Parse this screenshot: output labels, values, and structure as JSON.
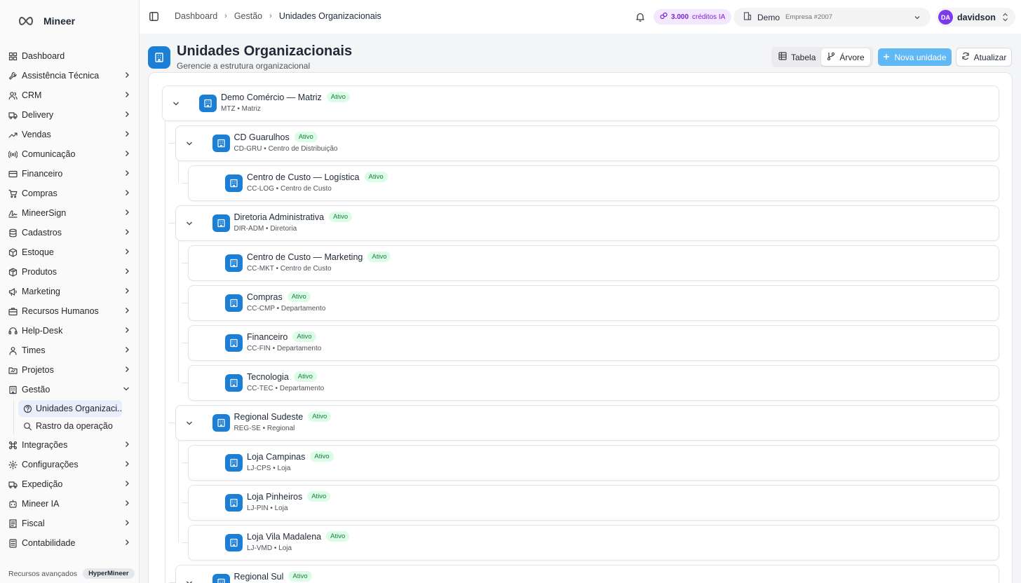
{
  "app": {
    "name": "Mineer"
  },
  "sidebar": {
    "items": [
      {
        "label": "Dashboard",
        "icon": "dashboard-icon",
        "chevron": false
      },
      {
        "label": "Assistência Técnica",
        "icon": "wrench-icon",
        "chevron": true
      },
      {
        "label": "CRM",
        "icon": "users-icon",
        "chevron": true
      },
      {
        "label": "Delivery",
        "icon": "truck-icon",
        "chevron": true
      },
      {
        "label": "Vendas",
        "icon": "trending-up-icon",
        "chevron": true
      },
      {
        "label": "Comunicação",
        "icon": "radio-icon",
        "chevron": true
      },
      {
        "label": "Financeiro",
        "icon": "credit-card-icon",
        "chevron": true
      },
      {
        "label": "Compras",
        "icon": "cart-icon",
        "chevron": true
      },
      {
        "label": "MineerSign",
        "icon": "signature-icon",
        "chevron": true
      },
      {
        "label": "Cadastros",
        "icon": "database-icon",
        "chevron": true
      },
      {
        "label": "Estoque",
        "icon": "package-icon",
        "chevron": true
      },
      {
        "label": "Produtos",
        "icon": "box-icon",
        "chevron": true
      },
      {
        "label": "Marketing",
        "icon": "megaphone-icon",
        "chevron": true
      },
      {
        "label": "Recursos Humanos",
        "icon": "briefcase-icon",
        "chevron": true
      },
      {
        "label": "Help-Desk",
        "icon": "headset-icon",
        "chevron": true
      },
      {
        "label": "Times",
        "icon": "team-icon",
        "chevron": true
      },
      {
        "label": "Projetos",
        "icon": "folder-icon",
        "chevron": true
      },
      {
        "label": "Gestão",
        "icon": "building-icon",
        "chevron": true,
        "expanded": true
      }
    ],
    "gestao_sub": [
      {
        "label": "Unidades Organizaci...",
        "icon": "help-circle-icon",
        "active": true
      },
      {
        "label": "Rastro da operação",
        "icon": "search-icon",
        "active": false
      }
    ],
    "items_after": [
      {
        "label": "Integrações",
        "icon": "command-icon",
        "chevron": true
      },
      {
        "label": "Configurações",
        "icon": "settings-icon",
        "chevron": true
      },
      {
        "label": "Expedição",
        "icon": "shipping-icon",
        "chevron": true
      },
      {
        "label": "Mineer IA",
        "icon": "ai-icon",
        "chevron": true
      },
      {
        "label": "Fiscal",
        "icon": "receipt-icon",
        "chevron": true
      },
      {
        "label": "Contabilidade",
        "icon": "calculator-icon",
        "chevron": true
      }
    ],
    "footer": {
      "label": "Recursos avançados",
      "badge": "HyperMineer"
    }
  },
  "topbar": {
    "breadcrumb": [
      "Dashboard",
      "Gestão",
      "Unidades Organizacionais"
    ],
    "credits": {
      "amount": "3.000",
      "label": "créditos IA"
    },
    "company": {
      "name": "Demo",
      "sub": "Empresa #2007"
    },
    "user": {
      "initials": "DA",
      "name": "davidson"
    }
  },
  "header": {
    "title": "Unidades Organizacionais",
    "subtitle": "Gerencie a estrutura organizacional",
    "view_table": "Tabela",
    "view_tree": "Árvore",
    "new_button": "Nova unidade",
    "refresh_button": "Atualizar"
  },
  "tree": [
    {
      "name": "Demo Comércio — Matriz",
      "status": "Ativo",
      "code": "MTZ",
      "type": "Matriz",
      "level": 0,
      "expandable": true
    },
    {
      "name": "CD Guarulhos",
      "status": "Ativo",
      "code": "CD-GRU",
      "type": "Centro de Distribuição",
      "level": 1,
      "expandable": true
    },
    {
      "name": "Centro de Custo — Logística",
      "status": "Ativo",
      "code": "CC-LOG",
      "type": "Centro de Custo",
      "level": 2,
      "expandable": false
    },
    {
      "name": "Diretoria Administrativa",
      "status": "Ativo",
      "code": "DIR-ADM",
      "type": "Diretoria",
      "level": 1,
      "expandable": true
    },
    {
      "name": "Centro de Custo — Marketing",
      "status": "Ativo",
      "code": "CC-MKT",
      "type": "Centro de Custo",
      "level": 2,
      "expandable": false
    },
    {
      "name": "Compras",
      "status": "Ativo",
      "code": "CC-CMP",
      "type": "Departamento",
      "level": 2,
      "expandable": false
    },
    {
      "name": "Financeiro",
      "status": "Ativo",
      "code": "CC-FIN",
      "type": "Departamento",
      "level": 2,
      "expandable": false
    },
    {
      "name": "Tecnologia",
      "status": "Ativo",
      "code": "CC-TEC",
      "type": "Departamento",
      "level": 2,
      "expandable": false
    },
    {
      "name": "Regional Sudeste",
      "status": "Ativo",
      "code": "REG-SE",
      "type": "Regional",
      "level": 1,
      "expandable": true
    },
    {
      "name": "Loja Campinas",
      "status": "Ativo",
      "code": "LJ-CPS",
      "type": "Loja",
      "level": 2,
      "expandable": false
    },
    {
      "name": "Loja Pinheiros",
      "status": "Ativo",
      "code": "LJ-PIN",
      "type": "Loja",
      "level": 2,
      "expandable": false
    },
    {
      "name": "Loja Vila Madalena",
      "status": "Ativo",
      "code": "LJ-VMD",
      "type": "Loja",
      "level": 2,
      "expandable": false
    },
    {
      "name": "Regional Sul",
      "status": "Ativo",
      "code": "",
      "type": "",
      "level": 1,
      "expandable": true
    }
  ],
  "colors": {
    "accent": "#1c7fd6",
    "primary_button": "#60b8f5",
    "badge_bg": "#dcfce7",
    "badge_text": "#15803d"
  }
}
